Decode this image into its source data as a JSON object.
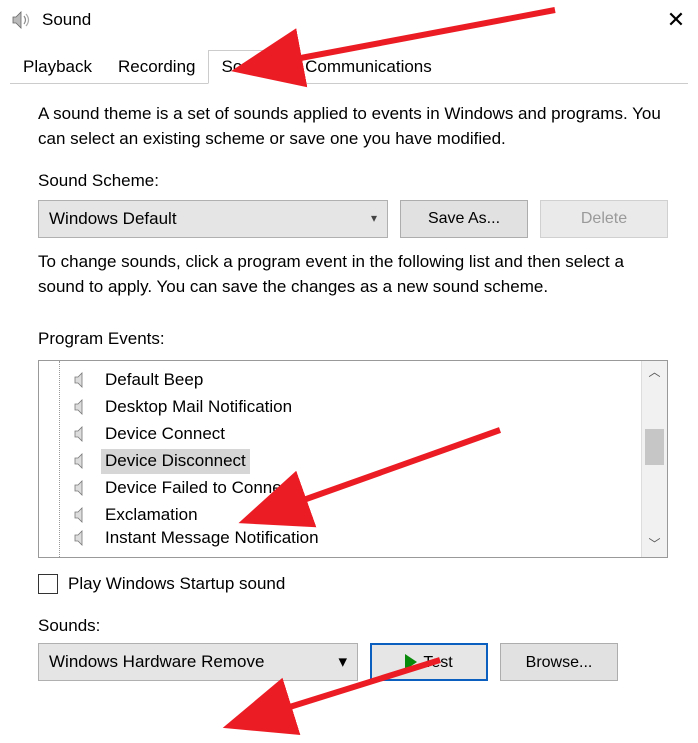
{
  "window": {
    "title": "Sound"
  },
  "tabs": {
    "playback": "Playback",
    "recording": "Recording",
    "sounds": "Sounds",
    "communications": "Communications",
    "active": "sounds"
  },
  "description": "A sound theme is a set of sounds applied to events in Windows and programs.  You can select an existing scheme or save one you have modified.",
  "sound_scheme": {
    "label": "Sound Scheme:",
    "selected": "Windows Default",
    "save_as": "Save As...",
    "delete": "Delete"
  },
  "change_text": "To change sounds, click a program event in the following list and then select a sound to apply.  You can save the changes as a new sound scheme.",
  "program_events": {
    "label": "Program Events:",
    "items": [
      "Default Beep",
      "Desktop Mail Notification",
      "Device Connect",
      "Device Disconnect",
      "Device Failed to Connect",
      "Exclamation",
      "Instant Message Notification"
    ],
    "selected_index": 3
  },
  "startup": {
    "label": "Play Windows Startup sound",
    "checked": false
  },
  "sounds": {
    "label": "Sounds:",
    "selected": "Windows Hardware Remove",
    "test": "Test",
    "browse": "Browse..."
  }
}
